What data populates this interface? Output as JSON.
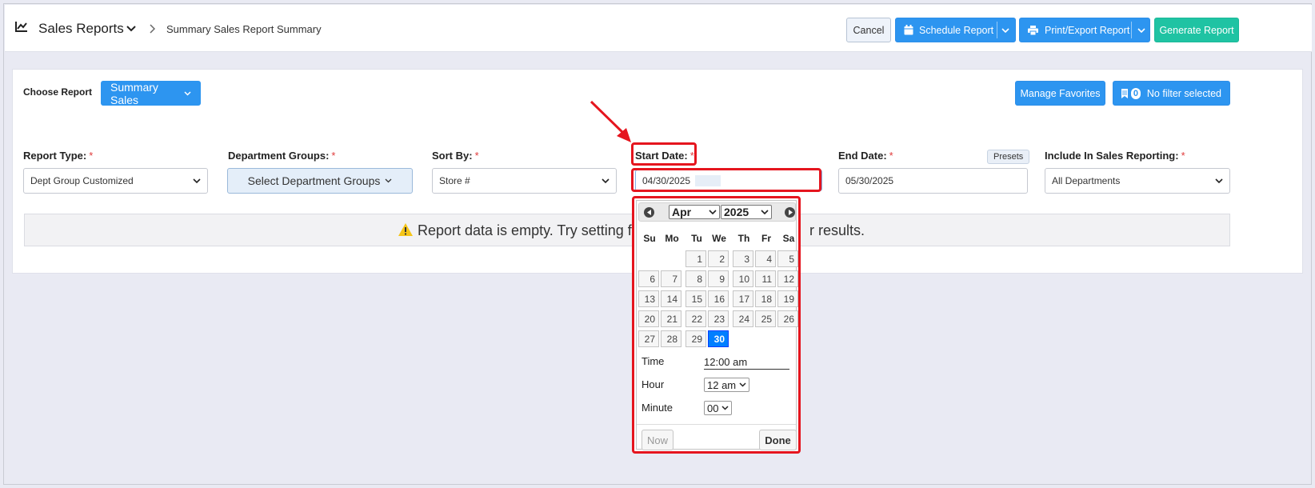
{
  "header": {
    "app_title": "Sales Reports",
    "breadcrumb": "Summary Sales Report Summary",
    "cancel_label": "Cancel",
    "schedule_label": "Schedule Report",
    "print_label": "Print/Export Report",
    "generate_label": "Generate Report"
  },
  "toolbar": {
    "choose_label": "Choose Report",
    "choose_value": "Summary Sales",
    "manage_favorites": "Manage Favorites",
    "filter_count": "0",
    "filter_label": "No filter selected"
  },
  "filters": {
    "report_type": {
      "label": "Report Type:",
      "value": "Dept Group Customized"
    },
    "department_groups": {
      "label": "Department Groups:",
      "value": "Select Department Groups"
    },
    "sort_by": {
      "label": "Sort By:",
      "value": "Store #"
    },
    "start_date": {
      "label": "Start Date:",
      "value": "04/30/2025"
    },
    "end_date": {
      "label": "End Date:",
      "value": "05/30/2025",
      "presets": "Presets"
    },
    "include_sales": {
      "label": "Include In Sales Reporting:",
      "value": "All Departments"
    },
    "required_mark": "*"
  },
  "message": {
    "empty_left": "Report data is empty. Try setting filte",
    "empty_right": "r results."
  },
  "datepicker": {
    "month": "Apr",
    "year": "2025",
    "weekdays": [
      "Su",
      "Mo",
      "Tu",
      "We",
      "Th",
      "Fr",
      "Sa"
    ],
    "days": [
      "1",
      "2",
      "3",
      "4",
      "5",
      "6",
      "7",
      "8",
      "9",
      "10",
      "11",
      "12",
      "13",
      "14",
      "15",
      "16",
      "17",
      "18",
      "19",
      "20",
      "21",
      "22",
      "23",
      "24",
      "25",
      "26",
      "27",
      "28",
      "29",
      "30"
    ],
    "first_weekday": 2,
    "selected_day": "30",
    "time_label": "Time",
    "time_value": "12:00 am",
    "hour_label": "Hour",
    "hour_value": "12 am",
    "minute_label": "Minute",
    "minute_value": "00",
    "now_label": "Now",
    "done_label": "Done"
  },
  "colors": {
    "primary": "#2d95f0",
    "success": "#1fc3a3",
    "highlight": "#e5151e",
    "selected": "#007fff"
  }
}
